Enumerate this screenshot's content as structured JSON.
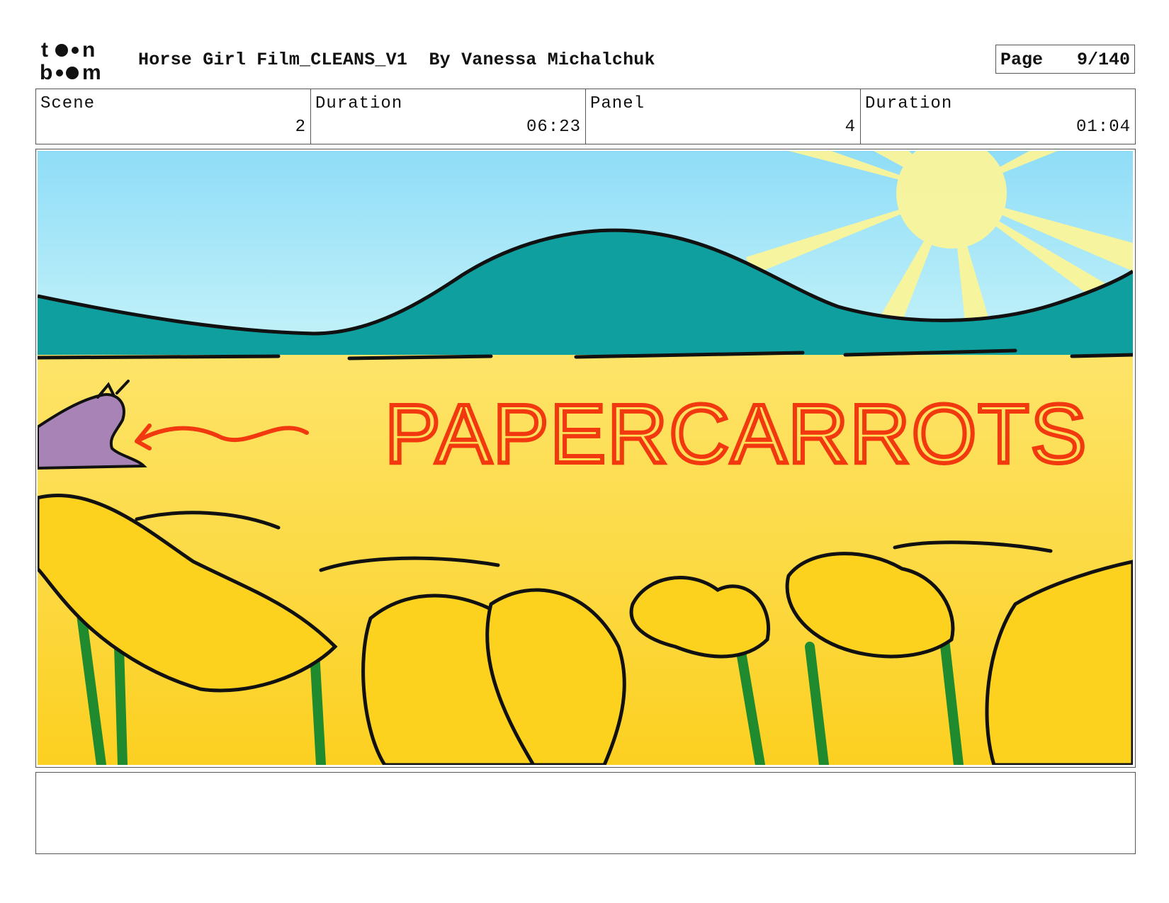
{
  "header": {
    "title": "Horse Girl Film_CLEANS_V1  By Vanessa Michalchuk",
    "page_label": "Page",
    "page_value": "9/140"
  },
  "info": {
    "scene_label": "Scene",
    "scene_value": "2",
    "scene_duration_label": "Duration",
    "scene_duration_value": "06:23",
    "panel_label": "Panel",
    "panel_value": "4",
    "panel_duration_label": "Duration",
    "panel_duration_value": "01:04"
  },
  "panel_art": {
    "caption": "PAPERCARROTS",
    "colors": {
      "sky": "#9fe4f7",
      "hills": "#0e9e9f",
      "field": "#fddb4c",
      "sun": "#fbf59a",
      "caption": "#f2380f",
      "horse": "#a783b6",
      "stems": "#1f8a2e"
    }
  },
  "notes": ""
}
